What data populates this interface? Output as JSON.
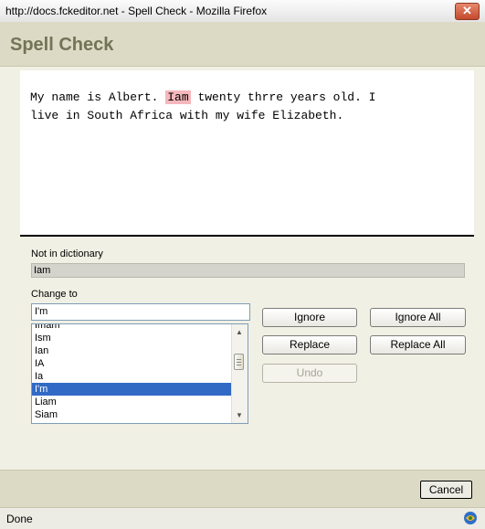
{
  "window": {
    "title": "http://docs.fckeditor.net - Spell Check - Mozilla Firefox",
    "close_glyph": "✕"
  },
  "dialog": {
    "title": "Spell Check"
  },
  "text": {
    "before": "My name is Albert. ",
    "misspelled": "Iam",
    "after_line1": " twenty thrre  years old. I",
    "line2": "live in South Africa with my wife Elizabeth."
  },
  "not_in_dictionary": {
    "label": "Not in dictionary",
    "value": "Iam"
  },
  "change_to": {
    "label": "Change to",
    "value": "I'm"
  },
  "suggestions": {
    "items": [
      "Imam",
      "Ism",
      "Ian",
      "IA",
      "Ia",
      "I'm",
      "Liam",
      "Siam"
    ],
    "selected": "I'm"
  },
  "buttons": {
    "ignore": "Ignore",
    "ignore_all": "Ignore All",
    "replace": "Replace",
    "replace_all": "Replace All",
    "undo": "Undo",
    "cancel": "Cancel"
  },
  "status": {
    "text": "Done"
  },
  "colors": {
    "misspelled_highlight": "#f4b7bb",
    "selection": "#316ac5",
    "dialog_header": "#dcdac4"
  },
  "icons": {
    "status_icon": "connection-status-icon"
  }
}
